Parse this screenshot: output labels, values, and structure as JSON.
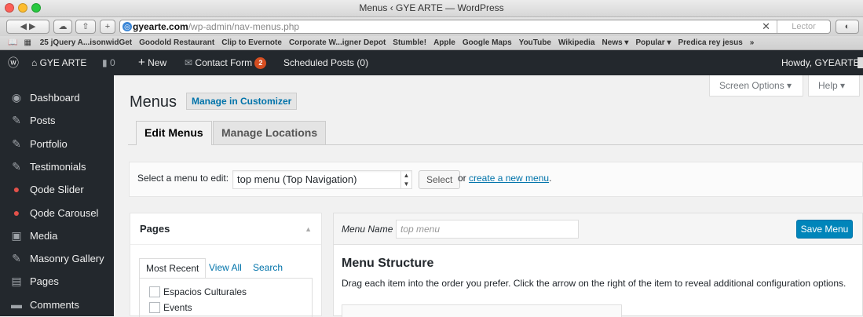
{
  "window": {
    "title": "Menus ‹ GYE ARTE — WordPress"
  },
  "browser": {
    "url_host": "gyearte.com",
    "url_path": "/wp-admin/nav-menus.php",
    "reader_label": "Lector",
    "clear_label": "✕"
  },
  "bookmarks": [
    "25 jQuery A...isonwidGet",
    "Goodold Restaurant",
    "Clip to Evernote",
    "Corporate W...igner Depot",
    "Stumble!",
    "Apple",
    "Google Maps",
    "YouTube",
    "Wikipedia",
    "News ▾",
    "Popular ▾",
    "Predica rey jesus",
    "»"
  ],
  "adminbar": {
    "site": "GYE ARTE",
    "comments": "0",
    "new": "New",
    "contact": "Contact Form",
    "contact_count": "2",
    "scheduled": "Scheduled Posts (0)",
    "howdy": "Howdy, GYEARTE"
  },
  "sidebar": {
    "items": [
      {
        "label": "Dashboard",
        "icon": "dashboard-icon"
      },
      {
        "label": "Posts",
        "icon": "pin-icon"
      },
      {
        "label": "Portfolio",
        "icon": "pin-icon"
      },
      {
        "label": "Testimonials",
        "icon": "pin-icon"
      },
      {
        "label": "Qode Slider",
        "icon": "qode-icon"
      },
      {
        "label": "Qode Carousel",
        "icon": "qode-icon"
      },
      {
        "label": "Media",
        "icon": "media-icon"
      },
      {
        "label": "Masonry Gallery",
        "icon": "pin-icon"
      },
      {
        "label": "Pages",
        "icon": "page-icon"
      },
      {
        "label": "Comments",
        "icon": "comment-icon"
      }
    ]
  },
  "screen": {
    "options": "Screen Options ▾",
    "help": "Help ▾"
  },
  "page": {
    "title": "Menus",
    "customizer": "Manage in Customizer",
    "tab_edit": "Edit Menus",
    "tab_locations": "Manage Locations"
  },
  "select_menu": {
    "label": "Select a menu to edit:",
    "value": "top menu (Top Navigation)",
    "button": "Select",
    "or": "or",
    "create_link": "create a new menu",
    "period": "."
  },
  "pages_box": {
    "title": "Pages",
    "tabs": [
      "Most Recent",
      "View All",
      "Search"
    ],
    "items": [
      "Espacios Culturales",
      "Events"
    ]
  },
  "menu_panel": {
    "name_label": "Menu Name",
    "name_value": "top menu",
    "save": "Save Menu",
    "structure_title": "Menu Structure",
    "help": "Drag each item into the order you prefer. Click the arrow on the right of the item to reveal additional configuration options."
  },
  "colors": {
    "admin_bar": "#23282d",
    "primary": "#0085ba",
    "link": "#0073aa",
    "badge": "#d54e21"
  }
}
